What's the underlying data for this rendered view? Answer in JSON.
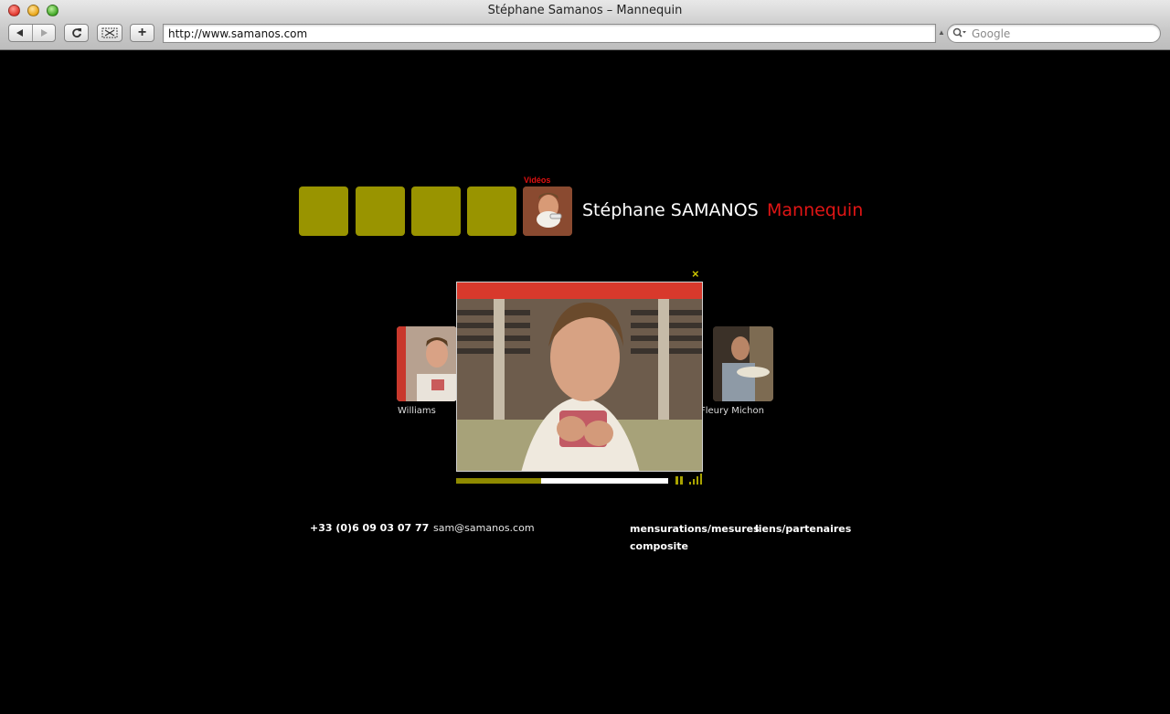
{
  "browser": {
    "window_title": "Stéphane Samanos – Mannequin",
    "url": "http://www.samanos.com",
    "search_placeholder": "Google",
    "add_tab_label": "+"
  },
  "header": {
    "videos_label": "Vidéos",
    "name": "Stéphane SAMANOS",
    "role": "Mannequin",
    "tile_color": "#999400",
    "role_color": "#e11515"
  },
  "carousel": {
    "left_label": "Williams",
    "right_label": "Fleury Michon",
    "close_glyph": "×"
  },
  "player": {
    "progress": 0.4
  },
  "footer": {
    "phone": "+33 (0)6 09 03 07 77",
    "email": "sam@samanos.com",
    "links": [
      "mensurations/mesures",
      "liens/partenaires",
      "composite"
    ]
  }
}
